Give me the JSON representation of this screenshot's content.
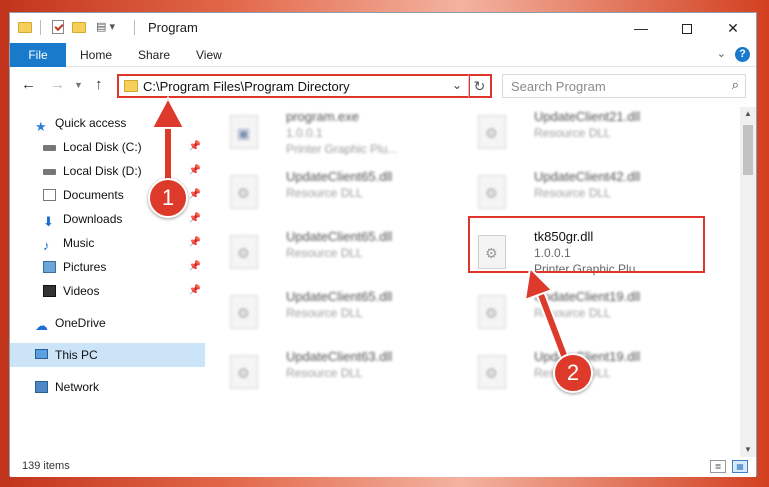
{
  "window": {
    "title": "Program",
    "controls": {
      "minimize": "—",
      "maximize": "",
      "close": "✕"
    }
  },
  "ribbon": {
    "tabs": [
      {
        "label": "File",
        "active": true
      },
      {
        "label": "Home"
      },
      {
        "label": "Share"
      },
      {
        "label": "View"
      }
    ],
    "expand_icon": "chevron-down",
    "help_label": "?"
  },
  "navbar": {
    "back": "←",
    "forward": "→",
    "recent": "⌄",
    "up": "↑",
    "address": "C:\\Program Files\\Program Directory",
    "address_dropdown": "⌄",
    "refresh": "↻",
    "search_placeholder": "Search Program",
    "search_icon": "⌕"
  },
  "sidebar": {
    "items": [
      {
        "label": "Quick access",
        "icon": "star-icon"
      },
      {
        "label": "Local Disk (C:)",
        "icon": "drive-icon",
        "pinned": true
      },
      {
        "label": "Local Disk (D:)",
        "icon": "drive-icon",
        "pinned": true
      },
      {
        "label": "Documents",
        "icon": "documents-icon",
        "pinned": true
      },
      {
        "label": "Downloads",
        "icon": "download-icon",
        "pinned": true
      },
      {
        "label": "Music",
        "icon": "music-icon",
        "pinned": true
      },
      {
        "label": "Pictures",
        "icon": "pictures-icon",
        "pinned": true
      },
      {
        "label": "Videos",
        "icon": "videos-icon",
        "pinned": true
      },
      {
        "label": "OneDrive",
        "icon": "cloud-icon"
      },
      {
        "label": "This PC",
        "icon": "computer-icon",
        "selected": true
      },
      {
        "label": "Network",
        "icon": "network-icon"
      }
    ],
    "pin_glyph": "📌"
  },
  "files": [
    {
      "name": "program.exe",
      "line2": "1.0.0.1",
      "line3": "Printer Graphic Plu...",
      "icon": "exe-icon"
    },
    {
      "name": "UpdateClient21.dll",
      "line2": "Resource DLL",
      "icon": "dll-icon"
    },
    {
      "name": "UpdateClient65.dll",
      "line2": "Resource DLL",
      "icon": "dll-icon"
    },
    {
      "name": "UpdateClient42.dll",
      "line2": "Resource DLL",
      "icon": "dll-icon"
    },
    {
      "name": "UpdateClient65.dll",
      "line2": "Resource DLL",
      "icon": "dll-icon"
    },
    {
      "name": "tk850gr.dll",
      "line2": "1.0.0.1",
      "line3": "Printer Graphic Plu...",
      "icon": "dll-icon",
      "highlighted": true
    },
    {
      "name": "UpdateClient65.dll",
      "line2": "Resource DLL",
      "icon": "dll-icon"
    },
    {
      "name": "UpdateClient19.dll",
      "line2": "Resource DLL",
      "icon": "dll-icon"
    },
    {
      "name": "UpdateClient63.dll",
      "line2": "Resource DLL",
      "icon": "dll-icon"
    },
    {
      "name": "UpdateClient19.dll",
      "line2": "Resource DLL",
      "icon": "dll-icon"
    }
  ],
  "statusbar": {
    "item_count": "139 items",
    "view_details": "≣",
    "view_tiles": "▦"
  },
  "callouts": [
    {
      "label": "1"
    },
    {
      "label": "2"
    }
  ],
  "colors": {
    "accent": "#1979ca",
    "highlight": "#e0352b",
    "selected_bg": "#cce4f7",
    "callout": "#de3a2c"
  }
}
